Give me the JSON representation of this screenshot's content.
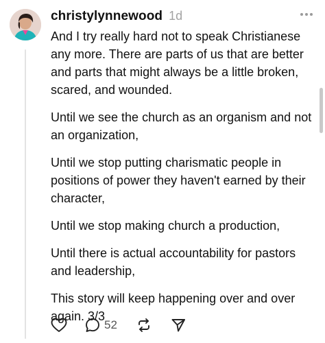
{
  "post": {
    "username": "christylynnewood",
    "time": "1d",
    "paragraphs": [
      "And I try really hard not to speak Christianese any more. There are parts of us that are better and parts that might always be a little broken, scared, and wounded.",
      "Until we see the church as an organism and not an organization,",
      "Until we stop putting charismatic people in positions of power they haven't earned by their character,",
      "Until we stop making church a production,",
      "Until there is actual accountability for pastors and leadership,",
      "This story will keep happening over and over again. 3/3"
    ],
    "actions": {
      "like_icon": "heart-icon",
      "reply_icon": "comment-icon",
      "reply_count": "52",
      "repost_icon": "repost-icon",
      "share_icon": "send-icon"
    }
  }
}
